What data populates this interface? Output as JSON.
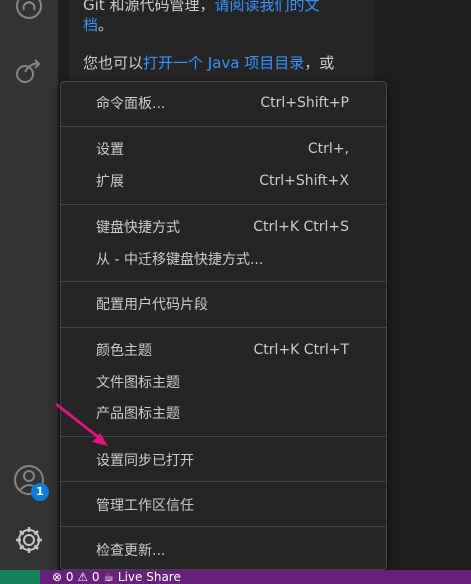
{
  "welcome": {
    "line1_text": "Git 和源代码管理，",
    "line1_link": "请阅读我们的文",
    "line2_link": "档",
    "line2_text": "。",
    "line3_text": "您也可以",
    "line3_link": "打开一个 Java 项目目录",
    "line3_tail": "，或"
  },
  "menu": {
    "items": [
      {
        "label": "命令面板...",
        "shortcut": "Ctrl+Shift+P"
      },
      {
        "label": "设置",
        "shortcut": "Ctrl+,"
      },
      {
        "label": "扩展",
        "shortcut": "Ctrl+Shift+X"
      },
      {
        "label": "键盘快捷方式",
        "shortcut": "Ctrl+K Ctrl+S"
      },
      {
        "label": "从 - 中迁移键盘快捷方式...",
        "shortcut": ""
      },
      {
        "label": "配置用户代码片段",
        "shortcut": ""
      },
      {
        "label": "颜色主题",
        "shortcut": "Ctrl+K Ctrl+T"
      },
      {
        "label": "文件图标主题",
        "shortcut": ""
      },
      {
        "label": "产品图标主题",
        "shortcut": ""
      },
      {
        "label": "设置同步已打开",
        "shortcut": ""
      },
      {
        "label": "管理工作区信任",
        "shortcut": ""
      },
      {
        "label": "检查更新...",
        "shortcut": ""
      }
    ]
  },
  "activity": {
    "accounts_badge": "1",
    "icons": [
      "github-icon",
      "share-icon",
      "account-icon",
      "gear-icon"
    ]
  },
  "statusbar": {
    "text": "⊗ 0  ⚠ 0   ☕ Live Share"
  },
  "colors": {
    "accent_link": "#3794ff",
    "badge": "#0e7bd4",
    "status_bar": "#68217a",
    "remote": "#16825d",
    "arrow": "#e5117f"
  }
}
